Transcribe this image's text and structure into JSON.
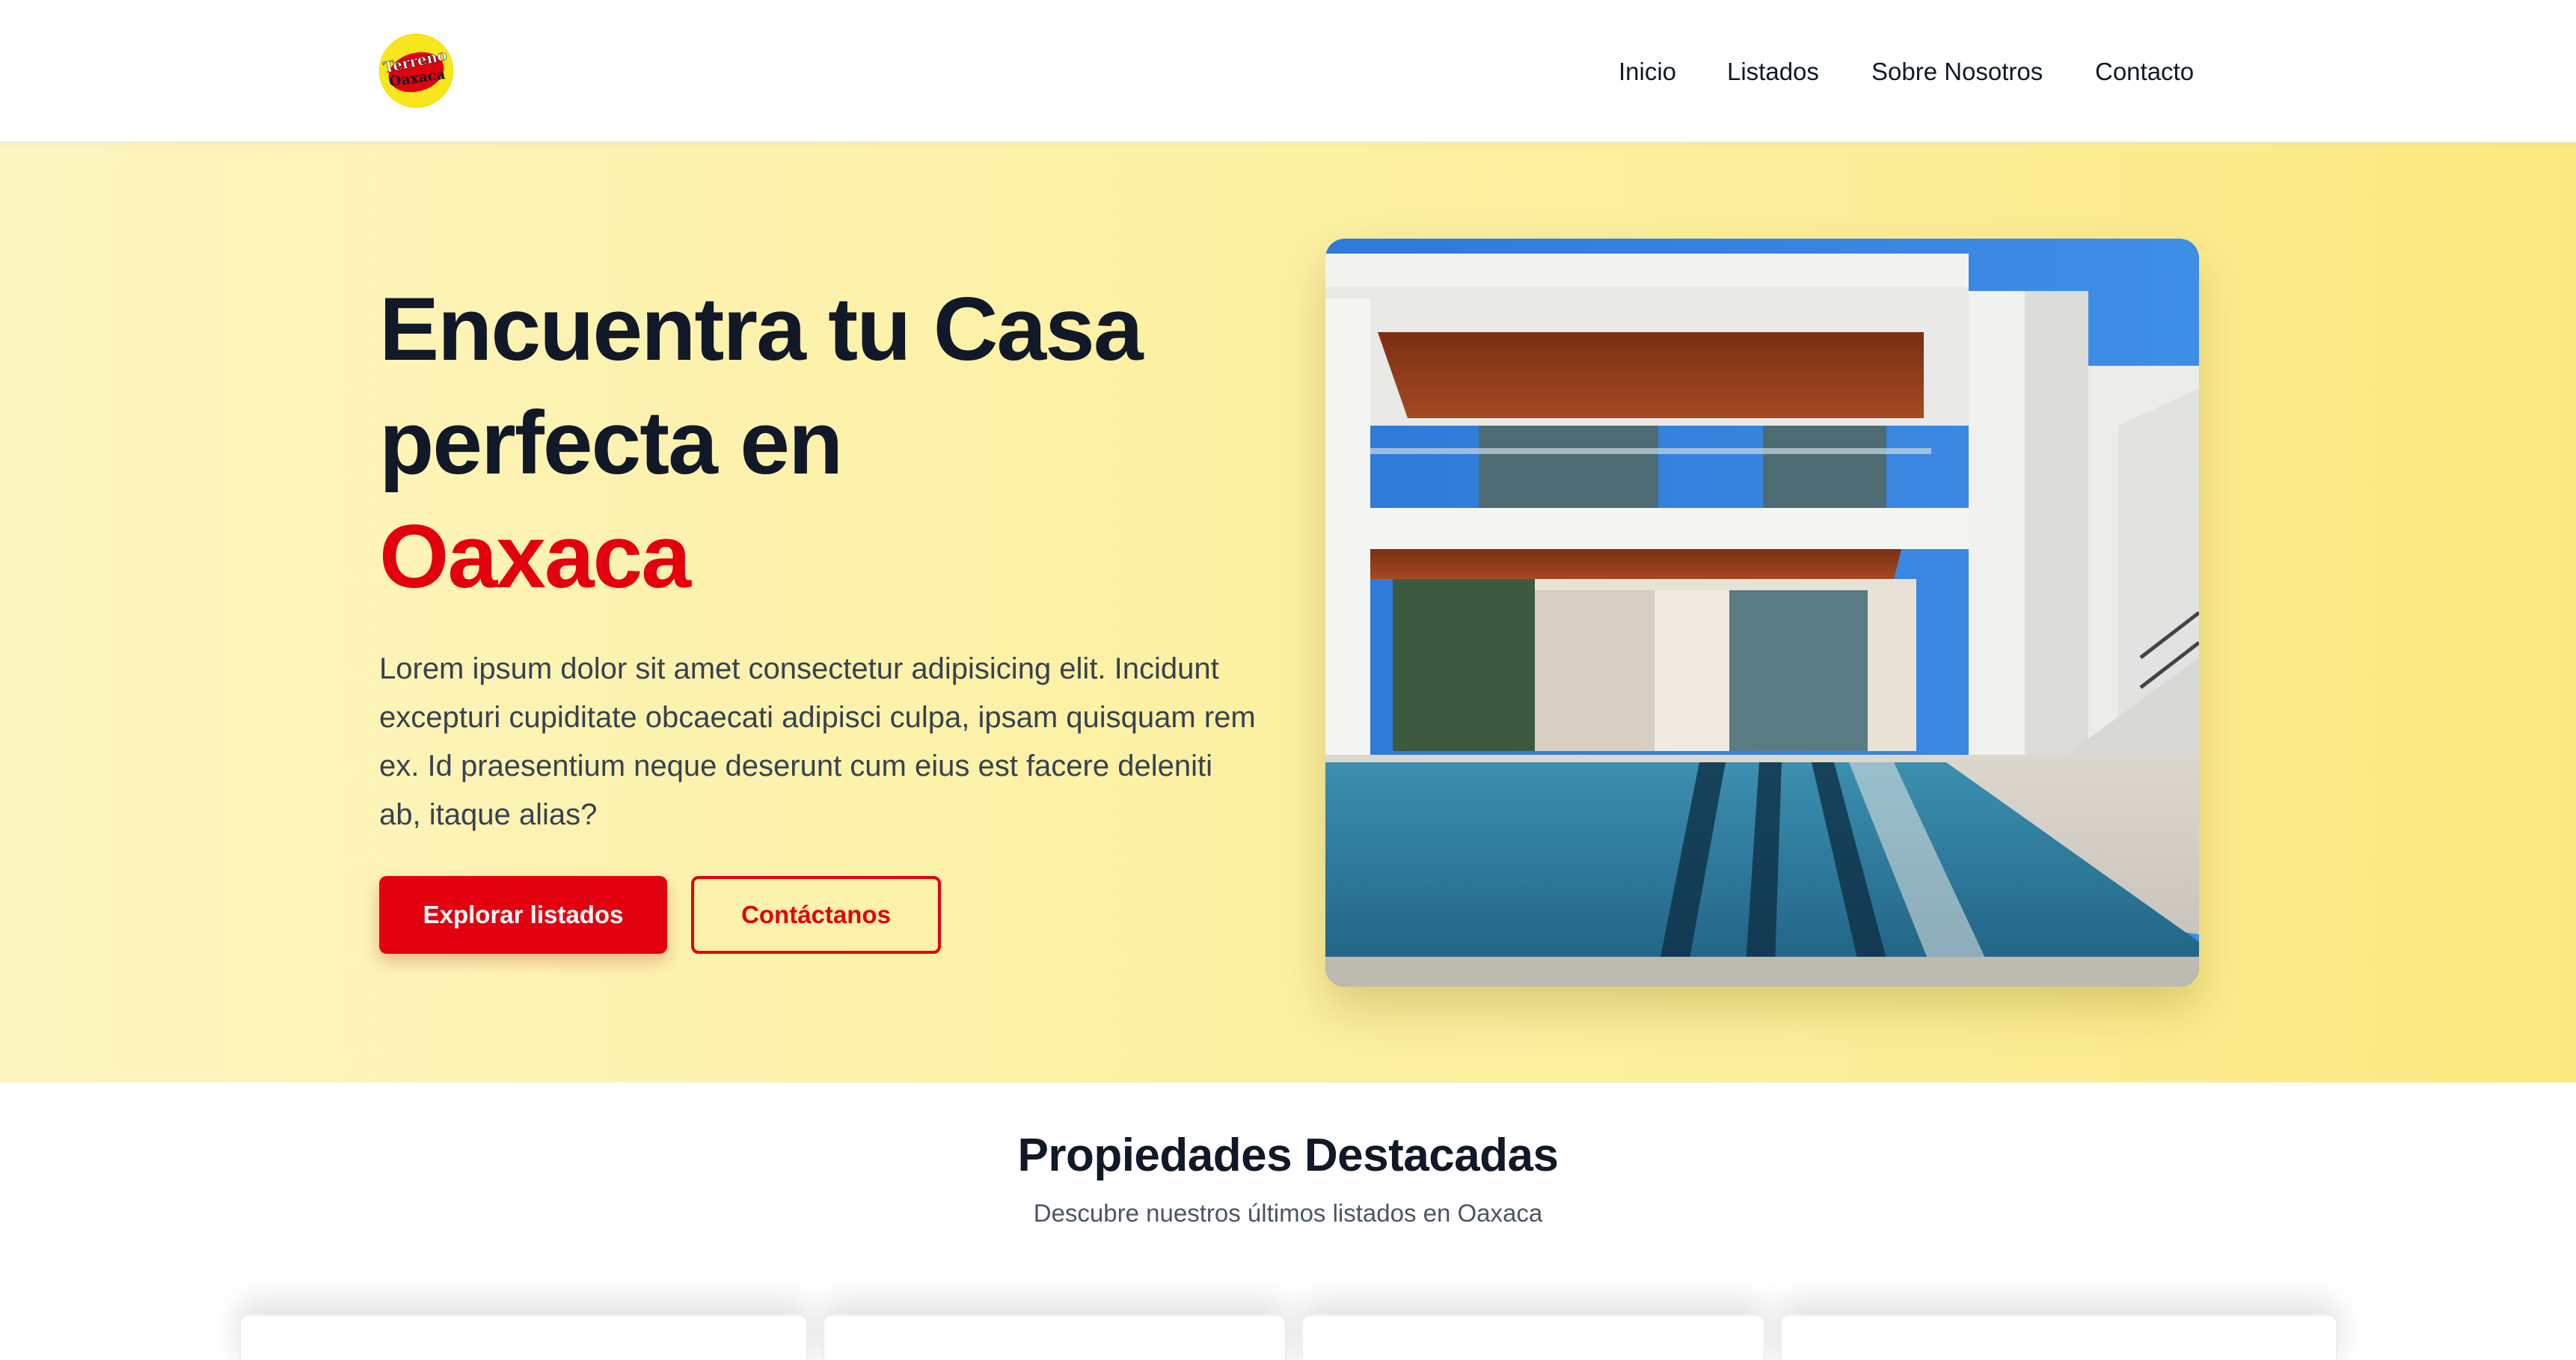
{
  "nav": {
    "logo_text_top": "Terreno",
    "logo_text_bottom": "Oaxaca",
    "items": [
      {
        "label": "Inicio"
      },
      {
        "label": "Listados"
      },
      {
        "label": "Sobre Nosotros"
      },
      {
        "label": "Contacto"
      }
    ]
  },
  "hero": {
    "title_line1": "Encuentra tu Casa",
    "title_line2": "perfecta en",
    "title_accent": "Oaxaca",
    "description": "Lorem ipsum dolor sit amet consectetur adipisicing elit. Incidunt excepturi cupiditate obcaecati adipisci culpa, ipsam quisquam rem ex. Id praesentium neque deserunt cum eius est facere deleniti ab, itaque alias?",
    "primary_button": "Explorar listados",
    "secondary_button": "Contáctanos",
    "image_alt": "modern-house-with-pool"
  },
  "featured": {
    "title": "Propiedades Destacadas",
    "subtitle": "Descubre nuestros últimos listados en Oaxaca"
  },
  "colors": {
    "accent": "#e3000f",
    "text_dark": "#111827",
    "hero_bg": "#fcee98",
    "logo_yellow": "#f8e71c"
  }
}
